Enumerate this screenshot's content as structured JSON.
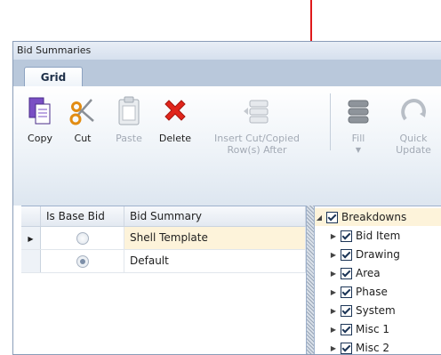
{
  "window": {
    "title": "Bid Summaries"
  },
  "ribbon": {
    "tabs": [
      {
        "label": "Grid"
      }
    ],
    "buttons": {
      "copy": "Copy",
      "cut": "Cut",
      "paste": "Paste",
      "delete": "Delete",
      "insert_line1": "Insert Cut/Copied",
      "insert_line2": "Row(s) After",
      "fill": "Fill",
      "quick_update": "Quick Update"
    }
  },
  "grid": {
    "columns": {
      "base": "Is Base Bid",
      "summary": "Bid Summary"
    },
    "rows": [
      {
        "is_base": false,
        "name": "Shell Template",
        "selected": true
      },
      {
        "is_base": true,
        "name": "Default",
        "selected": false
      }
    ]
  },
  "tree": {
    "root": {
      "label": "Breakdowns",
      "checked": true
    },
    "items": [
      {
        "label": "Bid Item",
        "checked": true
      },
      {
        "label": "Drawing",
        "checked": true
      },
      {
        "label": "Area",
        "checked": true
      },
      {
        "label": "Phase",
        "checked": true
      },
      {
        "label": "System",
        "checked": true
      },
      {
        "label": "Misc 1",
        "checked": true
      },
      {
        "label": "Misc 2",
        "checked": true
      }
    ]
  },
  "colors": {
    "annotation_arrow": "#e0191b",
    "selection": "#fdf3da",
    "ribbon": "#c3cfdf"
  }
}
